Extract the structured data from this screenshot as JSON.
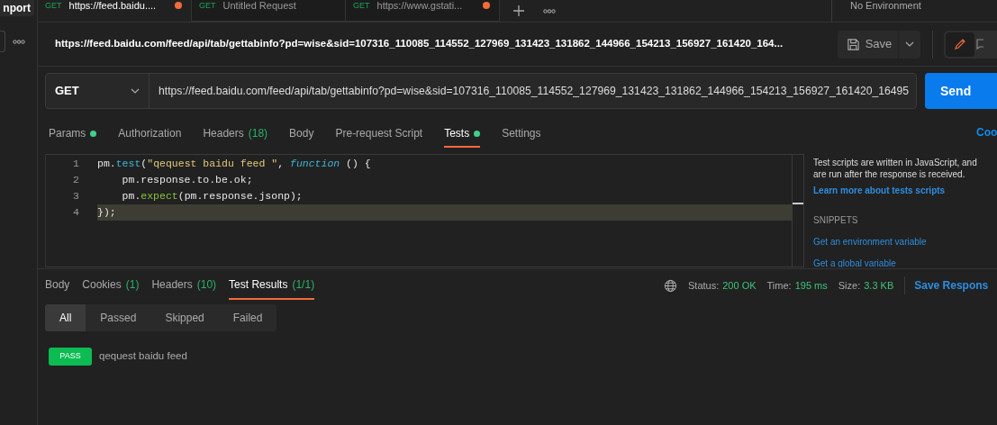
{
  "sidebar": {
    "import_button": "nport"
  },
  "tabs": [
    {
      "method": "GET",
      "title": "https://feed.baidu....",
      "unsaved": true,
      "selected": true
    },
    {
      "method": "GET",
      "title": "Untitled Request",
      "unsaved": false,
      "selected": false
    },
    {
      "method": "GET",
      "title": "https://www.gstati...",
      "unsaved": true,
      "selected": false
    }
  ],
  "environment": "No Environment",
  "request": {
    "title": "https://feed.baidu.com/feed/api/tab/gettabinfo?pd=wise&sid=107316_110085_114552_127969_131423_131862_144966_154213_156927_161420_164...",
    "save_button": "Save",
    "method": "GET",
    "url": "https://feed.baidu.com/feed/api/tab/gettabinfo?pd=wise&sid=107316_110085_114552_127969_131423_131862_144966_154213_156927_161420_16495",
    "send_button": "Send"
  },
  "request_tabs": [
    {
      "label": "Params",
      "dot": true,
      "selected": false
    },
    {
      "label": "Authorization",
      "dot": false,
      "selected": false
    },
    {
      "label": "Headers",
      "count": "(18)",
      "dot": false,
      "selected": false
    },
    {
      "label": "Body",
      "dot": false,
      "selected": false
    },
    {
      "label": "Pre-request Script",
      "dot": false,
      "selected": false
    },
    {
      "label": "Tests",
      "dot": true,
      "selected": true
    },
    {
      "label": "Settings",
      "dot": false,
      "selected": false
    }
  ],
  "cookies_link": "Coo",
  "editor": {
    "lines": [
      {
        "number": "1",
        "highlighted": false,
        "tokens": [
          {
            "text": "pm.",
            "kind": "plain"
          },
          {
            "text": "test",
            "kind": "method"
          },
          {
            "text": "(",
            "kind": "plain"
          },
          {
            "text": "\"qequest baidu feed \"",
            "kind": "string"
          },
          {
            "text": ", ",
            "kind": "plain"
          },
          {
            "text": "function",
            "kind": "keyword"
          },
          {
            "text": " () {",
            "kind": "plain"
          }
        ]
      },
      {
        "number": "2",
        "highlighted": false,
        "tokens": [
          {
            "text": "    pm.response.to.be.ok;",
            "kind": "plain"
          }
        ]
      },
      {
        "number": "3",
        "highlighted": false,
        "tokens": [
          {
            "text": "    pm.",
            "kind": "plain"
          },
          {
            "text": "expect",
            "kind": "call"
          },
          {
            "text": "(pm.response.jsonp);",
            "kind": "plain"
          }
        ]
      },
      {
        "number": "4",
        "highlighted": true,
        "tokens": [
          {
            "text": "});",
            "kind": "plain"
          }
        ]
      }
    ]
  },
  "help": {
    "description": "Test scripts are written in JavaScript, and are run after the response is received.",
    "learn_link": "Learn more about tests scripts",
    "snippets_heading": "SNIPPETS",
    "snippets": [
      "Get an environment variable",
      "Get a global variable"
    ]
  },
  "response_tabs": [
    {
      "label": "Body",
      "selected": false
    },
    {
      "label": "Cookies",
      "count": "(1)",
      "selected": false
    },
    {
      "label": "Headers",
      "count": "(10)",
      "selected": false
    },
    {
      "label": "Test Results",
      "count": "(1/1)",
      "selected": true
    }
  ],
  "response_meta": [
    {
      "label": "Status:",
      "value": "200 OK"
    },
    {
      "label": "Time:",
      "value": "195 ms"
    },
    {
      "label": "Size:",
      "value": "3.3 KB"
    }
  ],
  "save_response": "Save Respons",
  "filters": [
    {
      "label": "All",
      "selected": true
    },
    {
      "label": "Passed",
      "selected": false
    },
    {
      "label": "Skipped",
      "selected": false
    },
    {
      "label": "Failed",
      "selected": false
    }
  ],
  "results": [
    {
      "status": "PASS",
      "name": "qequest baidu feed"
    }
  ]
}
